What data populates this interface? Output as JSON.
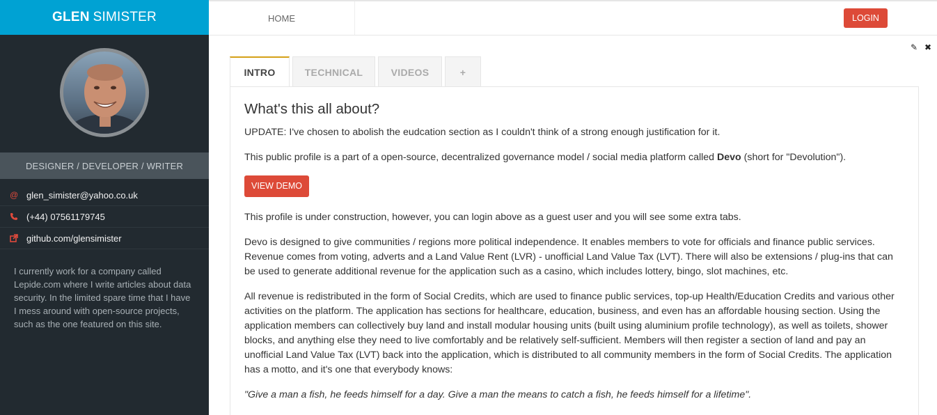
{
  "brand": {
    "first": "GLEN",
    "last": "SIMISTER"
  },
  "sidebar": {
    "role": "DESIGNER / DEVELOPER / WRITER",
    "contacts": [
      {
        "icon": "at-icon",
        "text": "glen_simister@yahoo.co.uk"
      },
      {
        "icon": "phone-icon",
        "text": "(+44) 07561179745"
      },
      {
        "icon": "external-link-icon",
        "text": "github.com/glensimister"
      }
    ],
    "bio": "I currently work for a company called Lepide.com where I write articles about data security. In the limited spare time that I have I mess around with open-source projects, such as the one featured on this site."
  },
  "nav": {
    "home": "HOME",
    "login": "LOGIN"
  },
  "tabs": [
    "INTRO",
    "TECHNICAL",
    "VIDEOS",
    "+"
  ],
  "content": {
    "heading": "What's this all about?",
    "update": "UPDATE: I've chosen to abolish the eudcation section as I couldn't think of a strong enough justification for it.",
    "profile_pre": "This public profile is a part of a open-source, decentralized governance model / social media platform called ",
    "profile_bold": "Devo",
    "profile_post": " (short for \"Devolution\").",
    "demo_button": "VIEW DEMO",
    "construction": "This profile is under construction, however, you can login above as a guest user and you will see some extra tabs.",
    "devo_design": "Devo is designed to give communities / regions more political independence. It enables members to vote for officials and finance public services. Revenue comes from voting, adverts and a Land Value Rent (LVR) - unofficial Land Value Tax (LVT). There will also be extensions / plug-ins that can be used to generate additional revenue for the application such as a casino, which includes lottery, bingo, slot machines, etc.",
    "revenue": "All revenue is redistributed in the form of Social Credits, which are used to finance public services, top-up Health/Education Credits and various other activities on the platform. The application has sections for healthcare, education, business, and even has an affordable housing section. Using the application members can collectively buy land and install modular housing units (built using aluminium profile technology), as well as toilets, shower blocks, and anything else they need to live comfortably and be relatively self-sufficient. Members will then register a section of land and pay an unofficial Land Value Tax (LVT) back into the application, which is distributed to all community members in the form of Social Credits. The application has a motto, and it's one that everybody knows:",
    "quote": "\"Give a man a fish, he feeds himself for a day. Give a man the means to catch a fish, he feeds himself for a lifetime\"."
  }
}
